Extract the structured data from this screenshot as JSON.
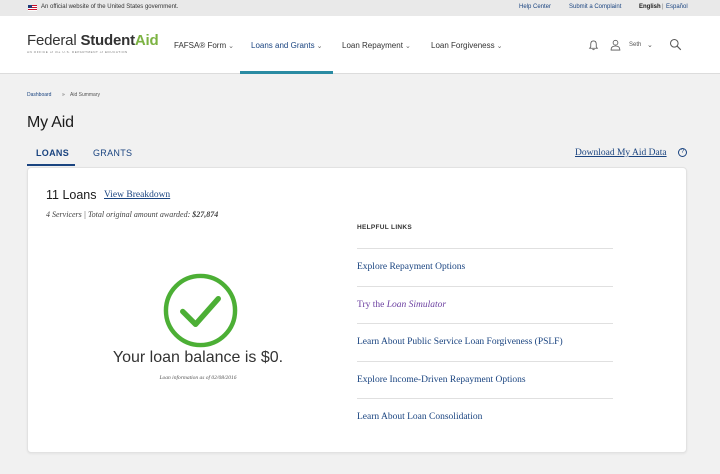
{
  "gov_banner": {
    "official_text": "An official website of the United States government.",
    "help_center": "Help Center",
    "submit_complaint": "Submit a Complaint",
    "english": "English",
    "separator": "|",
    "espanol": "Español"
  },
  "header": {
    "logo_regular": "Federal ",
    "logo_student": "Student",
    "logo_aid": "Aid",
    "logo_tagline": "AN OFFICE of the U.S. DEPARTMENT of EDUCATION",
    "nav": [
      {
        "label": "FAFSA® Form"
      },
      {
        "label": "Loans and Grants"
      },
      {
        "label": "Loan Repayment"
      },
      {
        "label": "Loan Forgiveness"
      }
    ],
    "user_name": "Seth"
  },
  "breadcrumb": {
    "dashboard": "Dashboard",
    "separator": "»",
    "current": "Aid Summary"
  },
  "page_title": "My Aid",
  "tabs": {
    "loans": "LOANS",
    "grants": "GRANTS",
    "download": "Download My Aid Data",
    "help_glyph": "?"
  },
  "summary": {
    "loans_count": "11 Loans",
    "view_breakdown": "View Breakdown",
    "servicers_prefix": "4 Servicers | Total original amount awarded: ",
    "servicers_amount": "$27,874",
    "balance": "Your loan balance is $0.",
    "as_of": "Loan information as of 02/08/2016"
  },
  "helpful_links": {
    "title": "HELPFUL LINKS",
    "items": [
      {
        "label": "Explore Repayment Options"
      },
      {
        "label_prefix": "Try the ",
        "label_italic": "Loan Simulator"
      },
      {
        "label": "Learn About Public Service Loan Forgiveness (PSLF)"
      },
      {
        "label": "Explore Income-Driven Repayment Options"
      },
      {
        "label": "Learn About Loan Consolidation"
      }
    ]
  },
  "colors": {
    "brand_navy": "#1a4480",
    "brand_green": "#7cb342",
    "check_green": "#4caf35",
    "visited_purple": "#6b3fa0",
    "nav_underline": "#2a8ba3"
  }
}
